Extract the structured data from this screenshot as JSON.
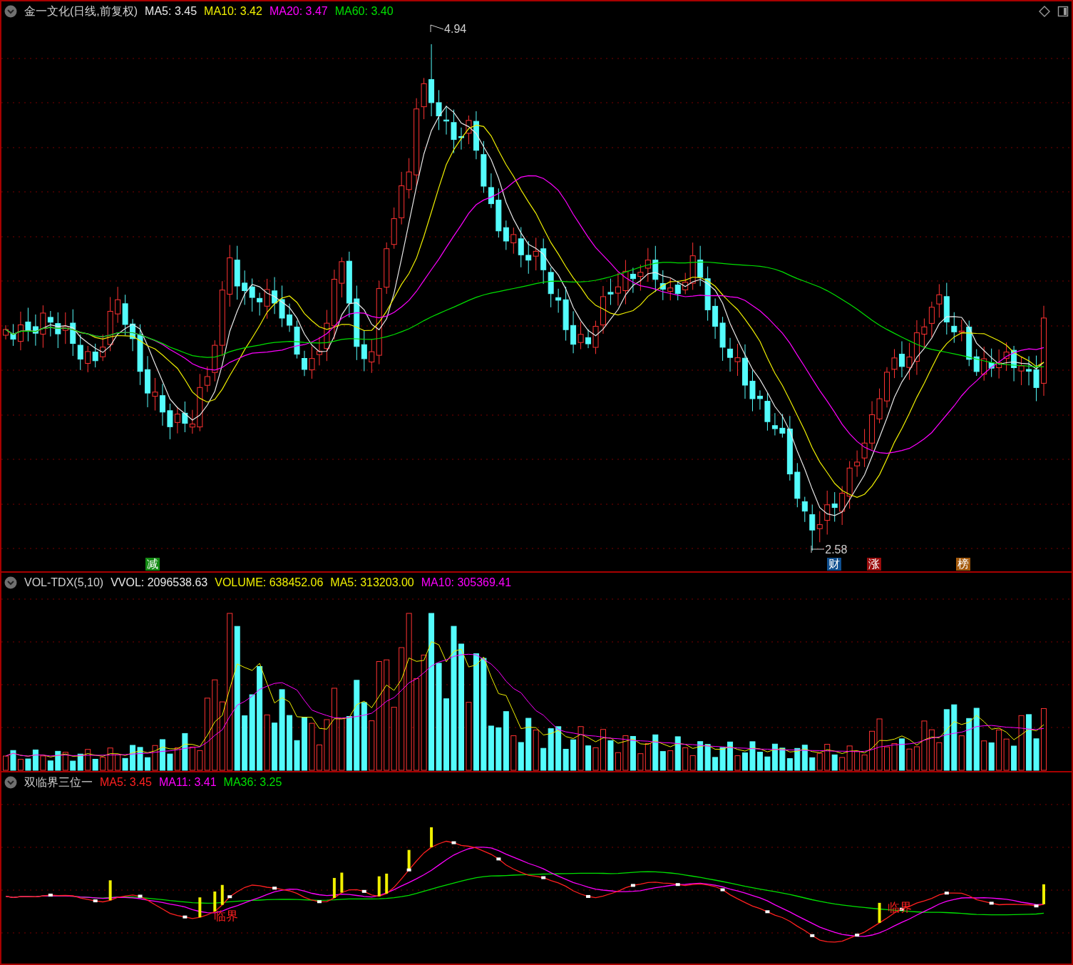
{
  "main_panel": {
    "title": "金一文化(日线,前复权)",
    "legend": [
      {
        "label": "MA5: 3.45",
        "color": "#e8e8e8"
      },
      {
        "label": "MA10: 3.42",
        "color": "#f0f000"
      },
      {
        "label": "MA20: 3.47",
        "color": "#ff00ff"
      },
      {
        "label": "MA60: 3.40",
        "color": "#00e000"
      }
    ],
    "high_label": "4.94",
    "low_label": "2.58",
    "event_badges": [
      {
        "label": "减",
        "color": "#138a13"
      },
      {
        "label": "财",
        "color": "#0f4f8f"
      },
      {
        "label": "涨",
        "color": "#9a0c0c"
      },
      {
        "label": "榜",
        "color": "#a45a0c"
      }
    ]
  },
  "volume_panel": {
    "title": "VOL-TDX(5,10)",
    "legend": [
      {
        "label": "VVOL: 2096538.63",
        "color": "#e8e8e8"
      },
      {
        "label": "VOLUME: 638452.06",
        "color": "#f0f000"
      },
      {
        "label": "MA5: 313203.00",
        "color": "#f0f000"
      },
      {
        "label": "MA10: 305369.41",
        "color": "#ff00ff"
      }
    ]
  },
  "indicator_panel": {
    "title": "双临界三位一",
    "legend": [
      {
        "label": "MA5: 3.45",
        "color": "#ff2020"
      },
      {
        "label": "MA11: 3.41",
        "color": "#ff00ff"
      },
      {
        "label": "MA36: 3.25",
        "color": "#00e000"
      }
    ],
    "signal_labels": [
      "临界",
      "临界"
    ]
  }
}
